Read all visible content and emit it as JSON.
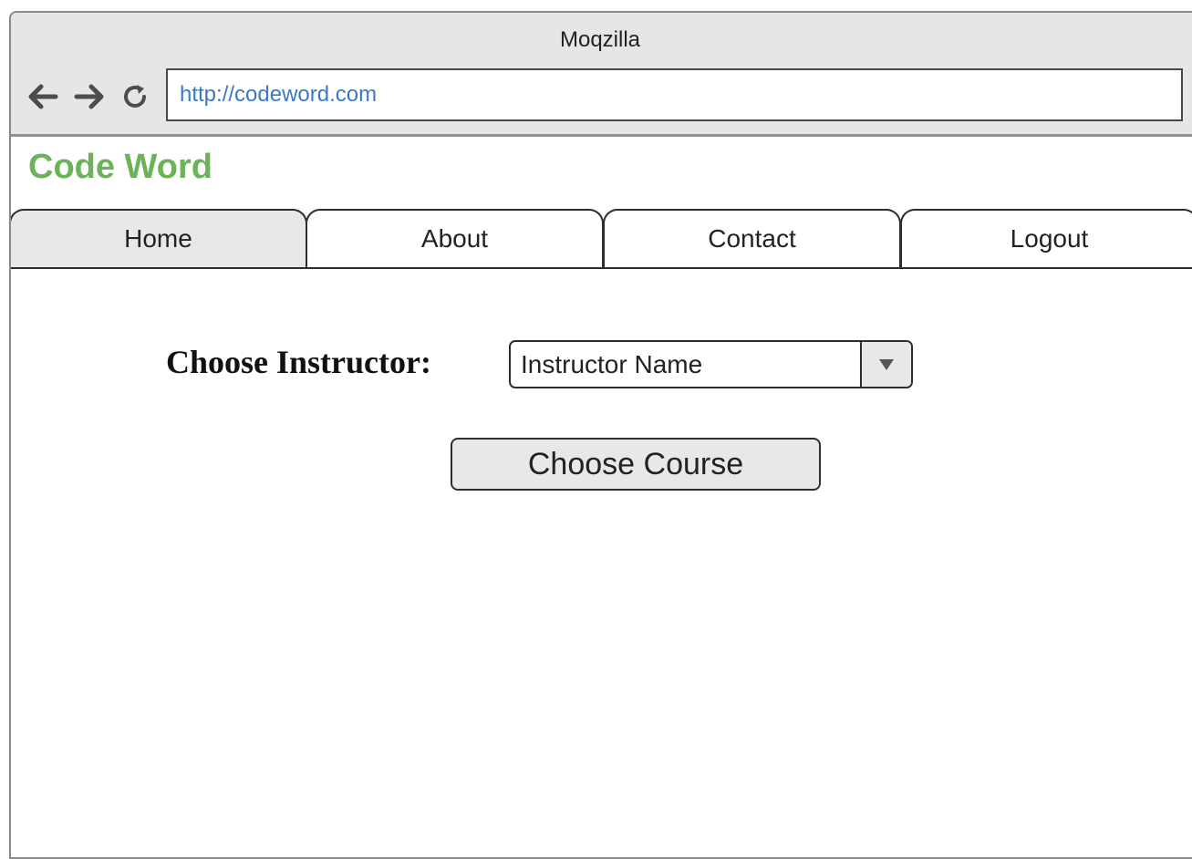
{
  "browser": {
    "title": "Moqzilla",
    "url": "http://codeword.com",
    "icons": {
      "back": "arrow-left-icon",
      "forward": "arrow-right-icon",
      "reload": "reload-icon"
    }
  },
  "site": {
    "logo": "Code Word",
    "logo_color": "#6cb257"
  },
  "tabs": [
    {
      "label": "Home",
      "active": true
    },
    {
      "label": "About",
      "active": false
    },
    {
      "label": "Contact",
      "active": false
    },
    {
      "label": "Logout",
      "active": false
    }
  ],
  "form": {
    "instructor_label": "Choose Instructor:",
    "instructor_select_value": "Instructor Name",
    "submit_label": "Choose Course"
  }
}
